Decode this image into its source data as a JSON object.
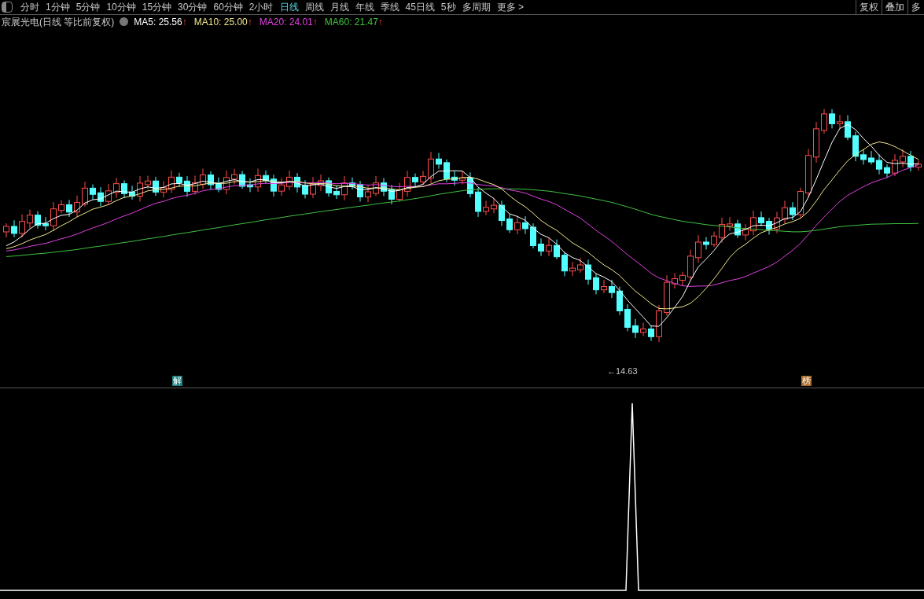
{
  "toolbar": {
    "periods": [
      {
        "label": "分时",
        "selected": false
      },
      {
        "label": "1分钟",
        "selected": false
      },
      {
        "label": "5分钟",
        "selected": false
      },
      {
        "label": "10分钟",
        "selected": false
      },
      {
        "label": "15分钟",
        "selected": false
      },
      {
        "label": "30分钟",
        "selected": false
      },
      {
        "label": "60分钟",
        "selected": false
      },
      {
        "label": "2小时",
        "selected": false
      },
      {
        "label": "日线",
        "selected": true
      },
      {
        "label": "周线",
        "selected": false
      },
      {
        "label": "月线",
        "selected": false
      },
      {
        "label": "年线",
        "selected": false
      },
      {
        "label": "季线",
        "selected": false
      },
      {
        "label": "45日线",
        "selected": false
      },
      {
        "label": "5秒",
        "selected": false
      },
      {
        "label": "多周期",
        "selected": false
      }
    ],
    "more": "更多 >",
    "actions": [
      "复权",
      "叠加",
      "多"
    ]
  },
  "legend": {
    "title": "宸展光电(日线 等比前复权)",
    "indicators": [
      {
        "label": "MA5: 25.56",
        "arrow": "↑",
        "color": "#ffffff"
      },
      {
        "label": "MA10: 25.00",
        "arrow": "↑",
        "color": "#f0e68c"
      },
      {
        "label": "MA20: 24.01",
        "arrow": "↑",
        "color": "#e040e0"
      },
      {
        "label": "MA60: 21.47",
        "arrow": "↑",
        "color": "#40c040"
      }
    ]
  },
  "main_chart": {
    "markers": [
      {
        "label": "解",
        "color": "#1f7f80"
      },
      {
        "label": "榜",
        "color": "#a8692a"
      }
    ],
    "low_label": "←14.63"
  }
}
